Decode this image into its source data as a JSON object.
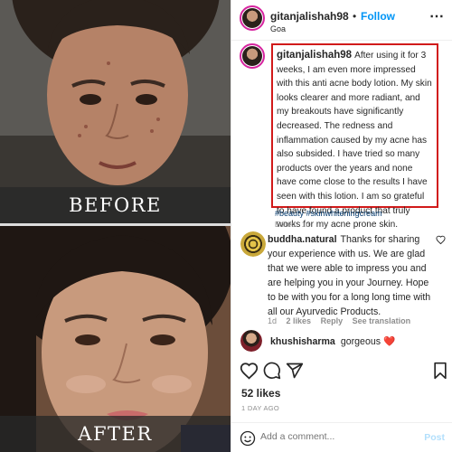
{
  "photos": {
    "before_label": "BEFORE",
    "after_label": "AFTER"
  },
  "header": {
    "username": "gitanjalishah98",
    "dot": "•",
    "follow_label": "Follow",
    "location": "Goa",
    "more_icon": "more-horizontal-icon"
  },
  "caption": {
    "username": "gitanjalishah98",
    "text": "After using it for 3 weeks, I am even more impressed with this anti acne body lotion. My skin looks clearer and more radiant, and my breakouts have significantly decreased. The redness and inflammation caused by my acne has also subsided. I have tried so many products over the years and none have come close to the results I have seen with this lotion. I am so grateful to have found a product that truly works for my acne prone skin.",
    "hashtags": "#beauty #skinwhiteningcream",
    "edited": "Edited · 1d"
  },
  "reply": {
    "username": "buddha.natural",
    "text": "Thanks for sharing your experience with us. We are glad that we were able to impress you and are helping you in your Journey. Hope to be with you for a long long time with all our Ayurvedic Products.",
    "time": "1d",
    "likes": "2 likes",
    "reply_label": "Reply",
    "see_translation": "See translation"
  },
  "comment2": {
    "username": "khushisharma",
    "text": "gorgeous ❤️"
  },
  "actions": {
    "like_icon": "heart-icon",
    "comment_icon": "comment-icon",
    "share_icon": "share-icon",
    "save_icon": "bookmark-icon"
  },
  "stats": {
    "likes": "52 likes",
    "time_ago": "1 DAY AGO"
  },
  "footer": {
    "placeholder": "Add a comment...",
    "post_label": "Post"
  },
  "colors": {
    "link": "#0095f6",
    "hashtag": "#00376b",
    "highlight_border": "#d11a1a",
    "post_disabled": "#b2dffc"
  }
}
